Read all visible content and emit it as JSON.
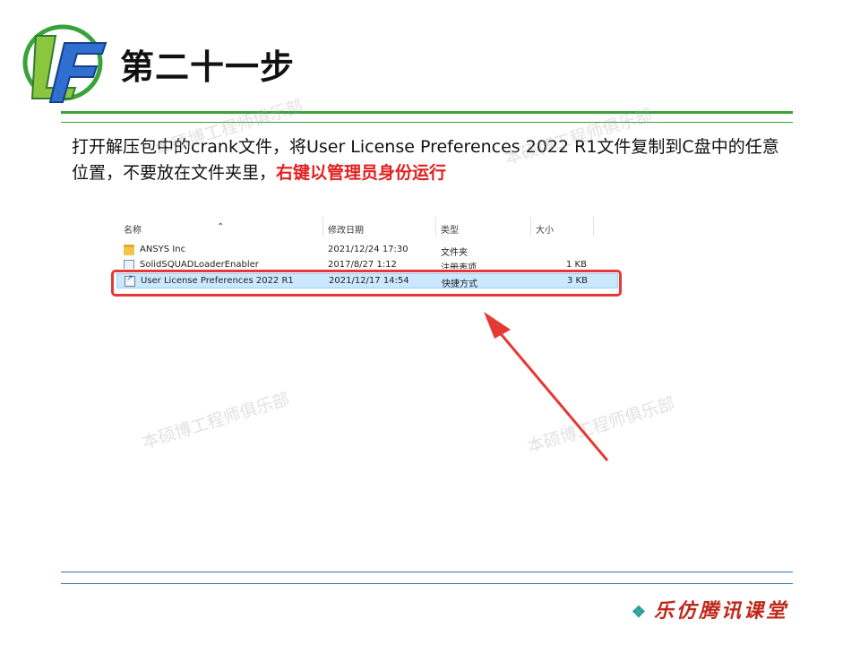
{
  "slide": {
    "title": "第二十一步",
    "instruction_plain": "打开解压包中的crank文件，将User License Preferences 2022 R1文件复制到C盘中的任意位置，不要放在文件夹里，",
    "instruction_highlight": "右键以管理员身份运行",
    "footer_brand": "乐仿腾讯课堂",
    "watermark": "本硕博工程师俱乐部"
  },
  "explorer": {
    "columns": [
      "名称",
      "修改日期",
      "类型",
      "大小"
    ],
    "rows": [
      {
        "name": "ANSYS Inc",
        "date": "2021/12/24 17:30",
        "type": "文件夹",
        "size": "",
        "icon": "folder-icon"
      },
      {
        "name": "SolidSQUADLoaderEnabler",
        "date": "2017/8/27 1:12",
        "type": "注册表项",
        "size": "1 KB",
        "icon": "registry-file-icon"
      },
      {
        "name": "User License Preferences 2022 R1",
        "date": "2021/12/17 14:54",
        "type": "快捷方式",
        "size": "3 KB",
        "icon": "shortcut-icon",
        "selected": true
      }
    ]
  },
  "colors": {
    "accent_green": "#3aa23a",
    "highlight_red": "#e53935",
    "footer_red": "#c0281a",
    "selection_blue": "#cce8ff"
  }
}
